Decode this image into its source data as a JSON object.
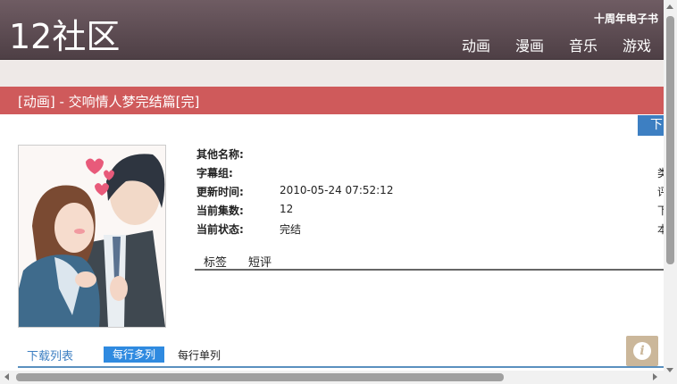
{
  "site": {
    "logo": "12社区",
    "anniversary": "十周年电子书"
  },
  "nav": [
    "动画",
    "漫画",
    "音乐",
    "游戏"
  ],
  "title": "[动画] - 交响情人梦完结篇[完]",
  "download_button": "下",
  "info": [
    {
      "label": "其他名称:",
      "value": ""
    },
    {
      "label": "字幕组:",
      "value": ""
    },
    {
      "label": "更新时间:",
      "value": "2010-05-24 07:52:12"
    },
    {
      "label": "当前集数:",
      "value": "12"
    },
    {
      "label": "当前状态:",
      "value": "完结"
    }
  ],
  "right_column": [
    "类",
    "评",
    "下",
    "本"
  ],
  "tabs": [
    "标签",
    "短评"
  ],
  "download_list": {
    "title": "下载列表",
    "multi": "每行多列",
    "single": "每行单列"
  },
  "colors": {
    "header": "#5f4d54",
    "titlebar": "#cf5a5b",
    "accent": "#2f8ae0"
  }
}
